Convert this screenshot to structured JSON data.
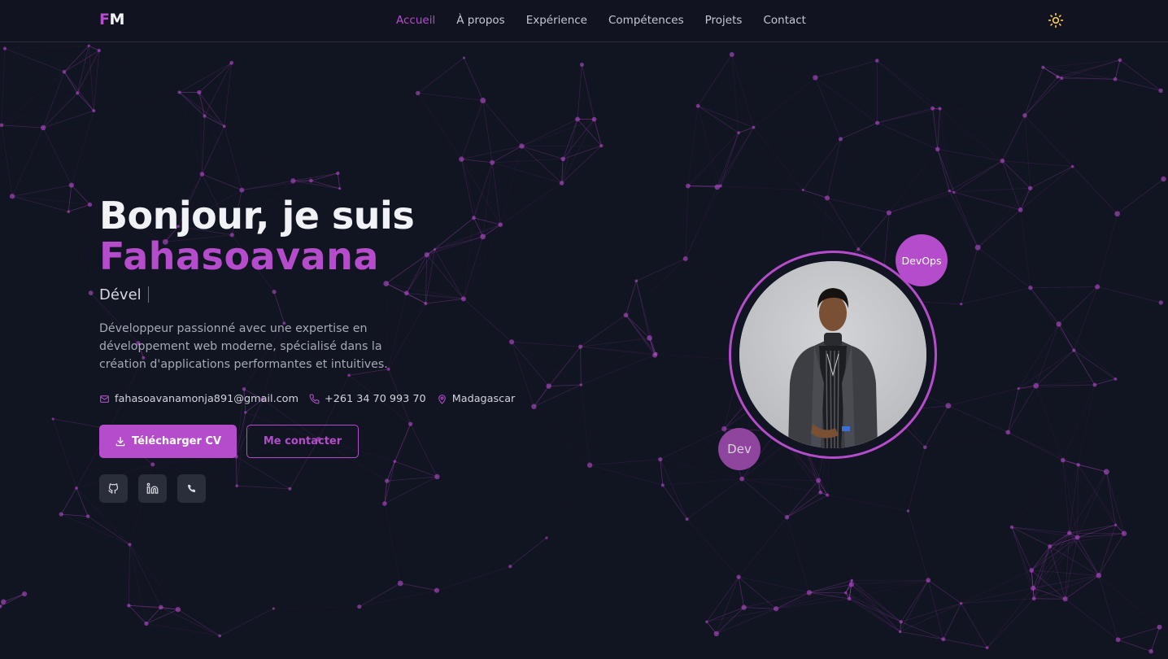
{
  "nav": {
    "logo_f": "F",
    "logo_m": "M",
    "links": [
      "Accueil",
      "À propos",
      "Expérience",
      "Compétences",
      "Projets",
      "Contact"
    ],
    "active_index": 0,
    "theme_icon": "sun-icon"
  },
  "hero": {
    "greeting": "Bonjour, je suis",
    "name": "Fahasoavana",
    "role_typed": "Dével",
    "bio": "Développeur passionné avec une expertise en développement web moderne, spécialisé dans la création d'applications performantes et intuitives.",
    "contacts": {
      "email": "fahasoavanamonja891@gmail.com",
      "phone": "+261 34 70 993 70",
      "location": "Madagascar"
    },
    "download_cv_label": "Télécharger CV",
    "contact_me_label": "Me contacter",
    "socials": [
      "github-icon",
      "linkedin-icon",
      "phone-icon"
    ]
  },
  "profile": {
    "badge_top": "DevOps",
    "badge_bottom": "Dev"
  },
  "colors": {
    "background": "#111421",
    "accent": "#b54ccb",
    "text": "#e5e7eb",
    "muted": "#a6a9b6"
  }
}
